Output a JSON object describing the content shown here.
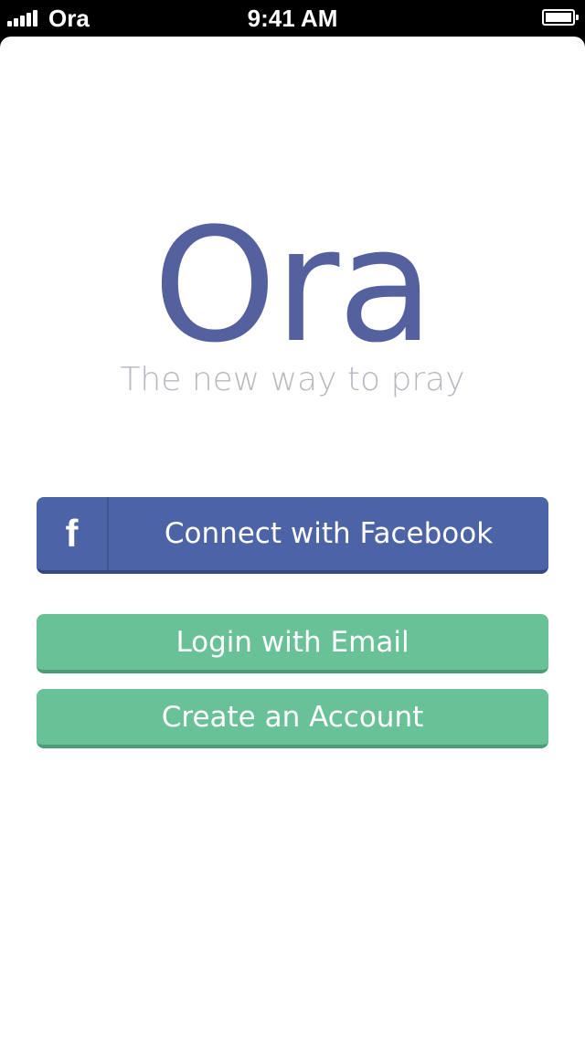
{
  "status_bar": {
    "carrier": "Ora",
    "time": "9:41 AM",
    "signal_bars": 5,
    "battery_level": 1.0
  },
  "app": {
    "logo": "Ora",
    "tagline": "The new way to pray"
  },
  "buttons": {
    "facebook_label": "Connect with Facebook",
    "facebook_icon": "f",
    "login_label": "Login with Email",
    "create_label": "Create an Account"
  },
  "colors": {
    "brand": "#55609f",
    "facebook": "#4c63a6",
    "green": "#69c198",
    "tagline": "#b7b9c0"
  }
}
